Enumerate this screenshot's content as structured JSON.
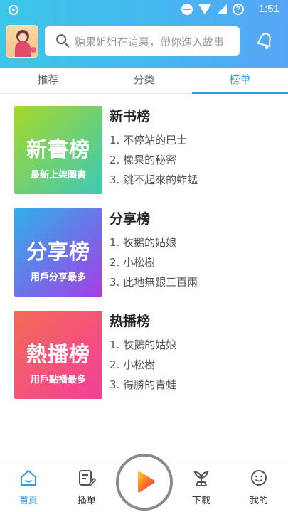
{
  "status_bar": {
    "time": "1:51"
  },
  "search": {
    "placeholder": "糖果姐姐在這裏，帶你進入故事"
  },
  "tabs": [
    {
      "label": "推荐",
      "active": false
    },
    {
      "label": "分类",
      "active": false
    },
    {
      "label": "榜单",
      "active": true
    }
  ],
  "rankings": [
    {
      "cover_title": "新書榜",
      "cover_subtitle": "最新上架圖書",
      "title": "新书榜",
      "items": [
        "1. 不停站的巴士",
        "2. 橡果的秘密",
        "3. 跳不起來的蚱蜢"
      ],
      "gradient": [
        "#a5d829",
        "#3dc9b8"
      ]
    },
    {
      "cover_title": "分享榜",
      "cover_subtitle": "用戶分享最多",
      "title": "分享榜",
      "items": [
        "1. 牧鵝的姑娘",
        "2. 小松樹",
        "3. 此地無銀三百兩"
      ],
      "gradient": [
        "#2fb0ea",
        "#a43de6"
      ]
    },
    {
      "cover_title": "熱播榜",
      "cover_subtitle": "用戶點播最多",
      "title": "热播榜",
      "items": [
        "1. 牧鵝的姑娘",
        "2. 小松樹",
        "3. 得勝的青蛙"
      ],
      "gradient": [
        "#f36b56",
        "#f43e9a"
      ]
    }
  ],
  "bottom_nav": [
    {
      "label": "首頁",
      "icon": "home-icon",
      "active": true
    },
    {
      "label": "播單",
      "icon": "playlist-icon",
      "active": false
    },
    {
      "label": "下載",
      "icon": "download-icon",
      "active": false
    },
    {
      "label": "我的",
      "icon": "profile-icon",
      "active": false
    }
  ],
  "colors": {
    "accent": "#2c9ce6",
    "header_start": "#3cc6e8",
    "header_end": "#57a6f5"
  }
}
